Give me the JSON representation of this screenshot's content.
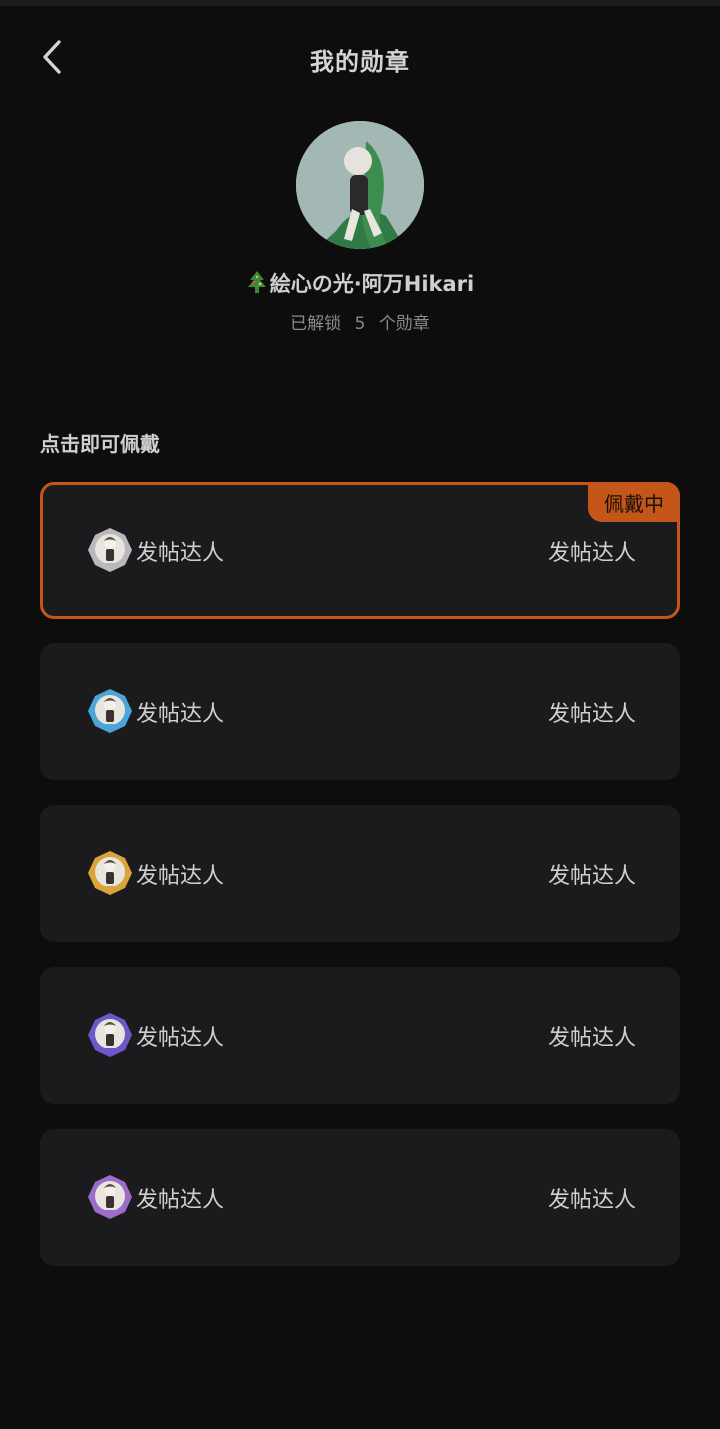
{
  "header": {
    "title": "我的勋章"
  },
  "profile": {
    "username": "絵心の光·阿万Hikari",
    "unlock_prefix": "已解锁",
    "unlock_count": "5",
    "unlock_suffix": "个勋章"
  },
  "section": {
    "title": "点击即可佩戴"
  },
  "badges": [
    {
      "name": "发帖达人",
      "title": "发帖达人",
      "color": "#b8b8bd",
      "wearing": true
    },
    {
      "name": "发帖达人",
      "title": "发帖达人",
      "color": "#4aa6d6",
      "wearing": false
    },
    {
      "name": "发帖达人",
      "title": "发帖达人",
      "color": "#d9a43a",
      "wearing": false
    },
    {
      "name": "发帖达人",
      "title": "发帖达人",
      "color": "#6c58c7",
      "wearing": false
    },
    {
      "name": "发帖达人",
      "title": "发帖达人",
      "color": "#9b6cc9",
      "wearing": false
    }
  ],
  "wearing_label": "佩戴中",
  "colors": {
    "accent": "#c4561a",
    "card_bg": "#1b1b1e",
    "page_bg": "#0d0d0e"
  }
}
